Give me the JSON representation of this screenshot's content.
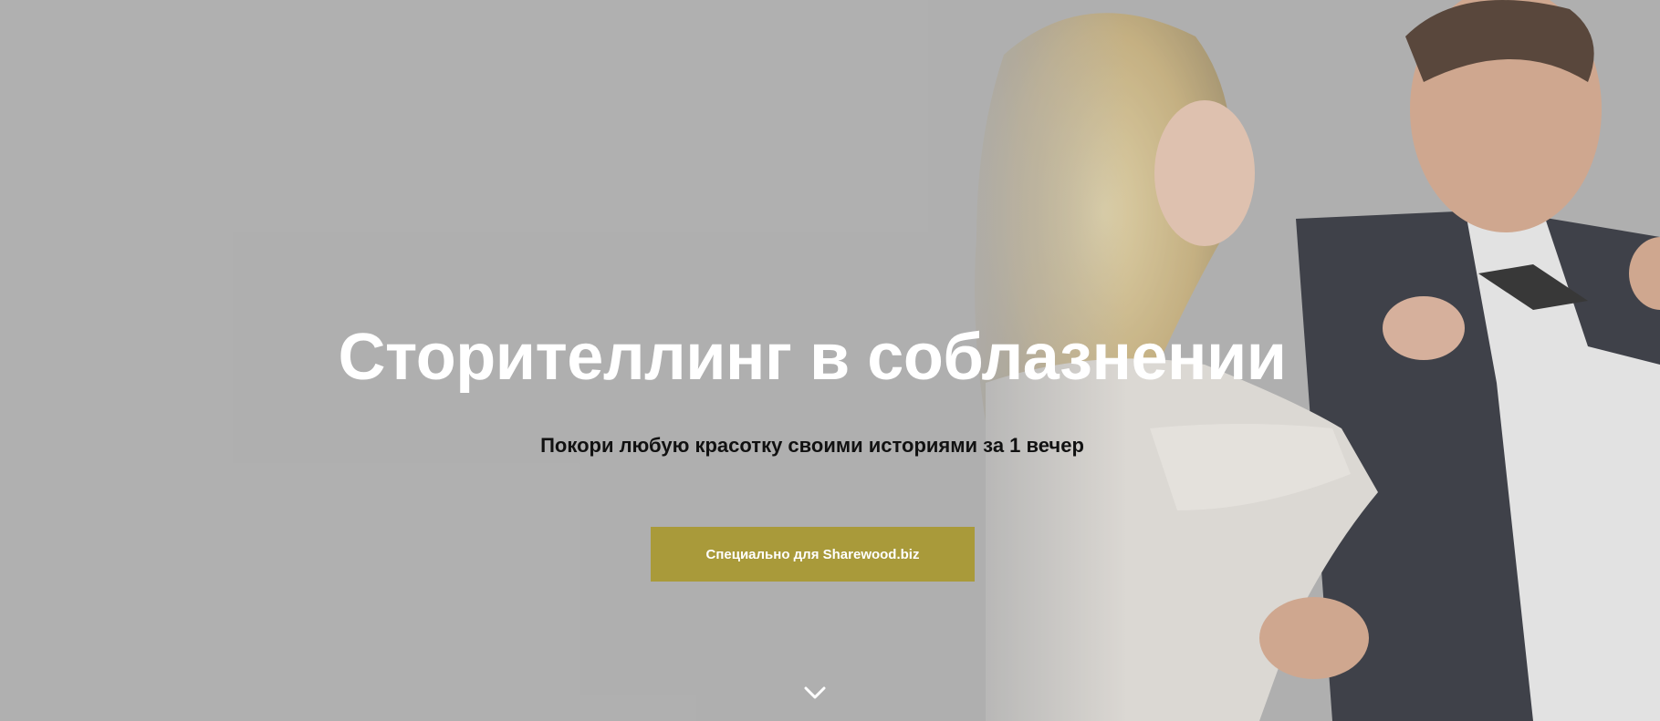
{
  "hero": {
    "title": "Сторителлинг в соблазнении",
    "subtitle": "Покори любую красотку своими историями за 1 вечер",
    "cta_label": "Специально для Sharewood.biz",
    "scroll_icon": "chevron-down-icon"
  },
  "colors": {
    "background": "#b3b3b3",
    "cta": "#a99a3a",
    "title": "#ffffff",
    "subtitle": "#111111"
  }
}
